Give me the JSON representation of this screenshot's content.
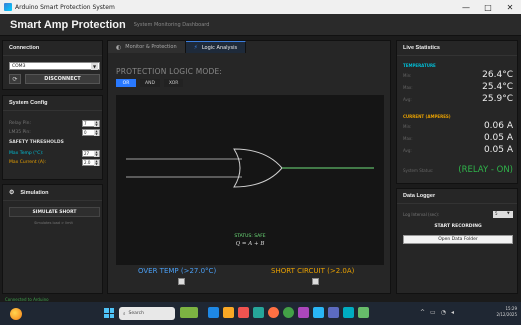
{
  "window": {
    "title": "Arduino Smart Protection System",
    "minimize": "—",
    "maximize": "□",
    "close": "✕"
  },
  "header": {
    "app_name": "Smart Amp Protection",
    "subtitle": "System Monitoring Dashboard"
  },
  "connection": {
    "title": "Connection",
    "port_value": "COM3",
    "refresh_label": "⟳",
    "disconnect_label": "DISCONNECT"
  },
  "system_config": {
    "title": "System Config",
    "relay_pin_label": "Relay Pin:",
    "relay_pin_value": "7",
    "lm35_pin_label": "LM35 Pin:",
    "lm35_pin_value": "0",
    "safety_title": "SAFETY THRESHOLDS",
    "max_temp_label": "Max Temp (°C):",
    "max_temp_value": "27",
    "max_current_label": "Max Current (A):",
    "max_current_value": "2.0"
  },
  "simulation": {
    "title": "Simulation",
    "button_label": "SIMULATE SHORT",
    "note": "Simulates load > limit"
  },
  "status_bar": {
    "text": "Connected to Arduino"
  },
  "center": {
    "tabs": [
      {
        "label": "Monitor & Protection",
        "icon": "monitor-icon"
      },
      {
        "label": "Logic Analysis",
        "icon": "logic-icon"
      }
    ],
    "logic_mode_label": "PROTECTION LOGIC MODE:",
    "gates": [
      "OR",
      "AND",
      "XOR"
    ],
    "status_text": "STATUS: SAFE",
    "formula": "Q = A + B",
    "input_a_label": "OVER TEMP (>27.0°C)",
    "input_b_label": "SHORT CIRCUIT (>2.0A)",
    "colors": {
      "accent": "#2979ff",
      "input_a": "#4a9ff5",
      "input_b": "#e8a000",
      "output": "#6ee07a"
    }
  },
  "live_stats": {
    "title": "Live Statistics",
    "temperature": {
      "heading": "TEMPERATURE",
      "min_label": "Min:",
      "min_value": "26.4°C",
      "max_label": "Max:",
      "max_value": "25.4°C",
      "avg_label": "Avg:",
      "avg_value": "25.9°C"
    },
    "current": {
      "heading": "CURRENT (AMPERES)",
      "min_label": "Min:",
      "min_value": "0.06 A",
      "max_label": "Max:",
      "max_value": "0.05 A",
      "avg_label": "Avg:",
      "avg_value": "0.05 A"
    },
    "system_status_label": "System Status:",
    "system_status_value": "(RELAY - ON)"
  },
  "data_logger": {
    "title": "Data Logger",
    "interval_label": "Log Interval (sec):",
    "interval_value": "5",
    "start_label": "START RECORDING",
    "open_folder_label": "Open Data Folder"
  },
  "taskbar": {
    "search_label": "Search",
    "time": "15:29",
    "date": "2/12/2025"
  }
}
